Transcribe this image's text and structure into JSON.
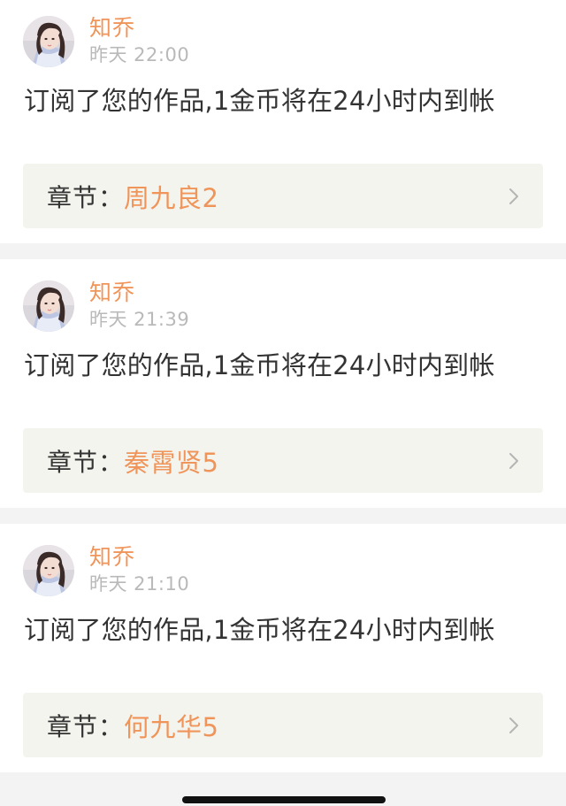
{
  "notifications": [
    {
      "user": {
        "name": "知乔",
        "avatar": "user-avatar"
      },
      "time": "昨天 22:00",
      "message": "订阅了您的作品,1金币将在24小时内到帐",
      "chapter": {
        "label": "章节：",
        "title": "周九良2"
      }
    },
    {
      "user": {
        "name": "知乔",
        "avatar": "user-avatar"
      },
      "time": "昨天 21:39",
      "message": "订阅了您的作品,1金币将在24小时内到帐",
      "chapter": {
        "label": "章节：",
        "title": "秦霄贤5"
      }
    },
    {
      "user": {
        "name": "知乔",
        "avatar": "user-avatar"
      },
      "time": "昨天 21:10",
      "message": "订阅了您的作品,1金币将在24小时内到帐",
      "chapter": {
        "label": "章节：",
        "title": "何九华5"
      }
    }
  ],
  "colors": {
    "accent": "#f0955a",
    "text": "#333333",
    "muted": "#b9b9b9",
    "chapter_bg": "#f4f4ef",
    "page_bg": "#f3f3f3"
  },
  "icons": {
    "chapter_chevron": "chevron-right-icon"
  }
}
